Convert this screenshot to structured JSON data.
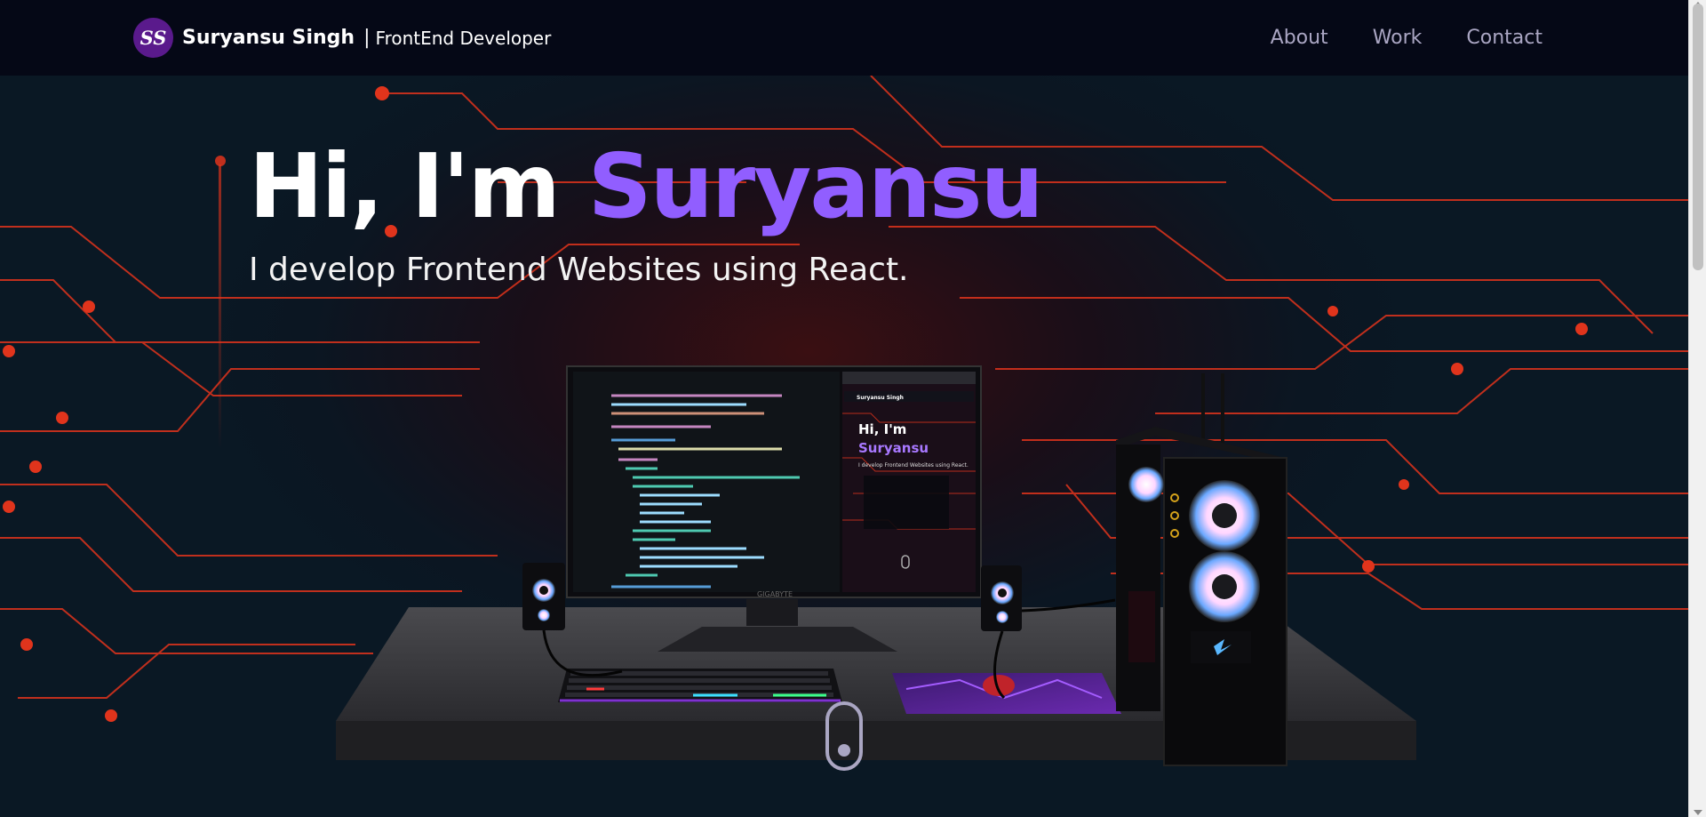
{
  "navbar": {
    "logo_text": "SS",
    "name": "Suryansu Singh",
    "separator": "|",
    "role": "FrontEnd Developer",
    "links": [
      {
        "label": "About"
      },
      {
        "label": "Work"
      },
      {
        "label": "Contact"
      }
    ]
  },
  "hero": {
    "title_prefix": "Hi, I'm ",
    "title_name": "Suryansu",
    "subtitle": "I develop Frontend Websites using React.",
    "monitor_brand": "GIGABYTE",
    "mini_title_line1": "Hi, I'm",
    "mini_title_line2": "Suryansu",
    "mini_subtitle": "I develop Frontend Websites using React.",
    "mini_brand": "Suryansu Singh"
  },
  "colors": {
    "background": "#050816",
    "accent": "#915eff",
    "circuit": "#ff3b1f",
    "nav_link": "#aaa6c3"
  }
}
